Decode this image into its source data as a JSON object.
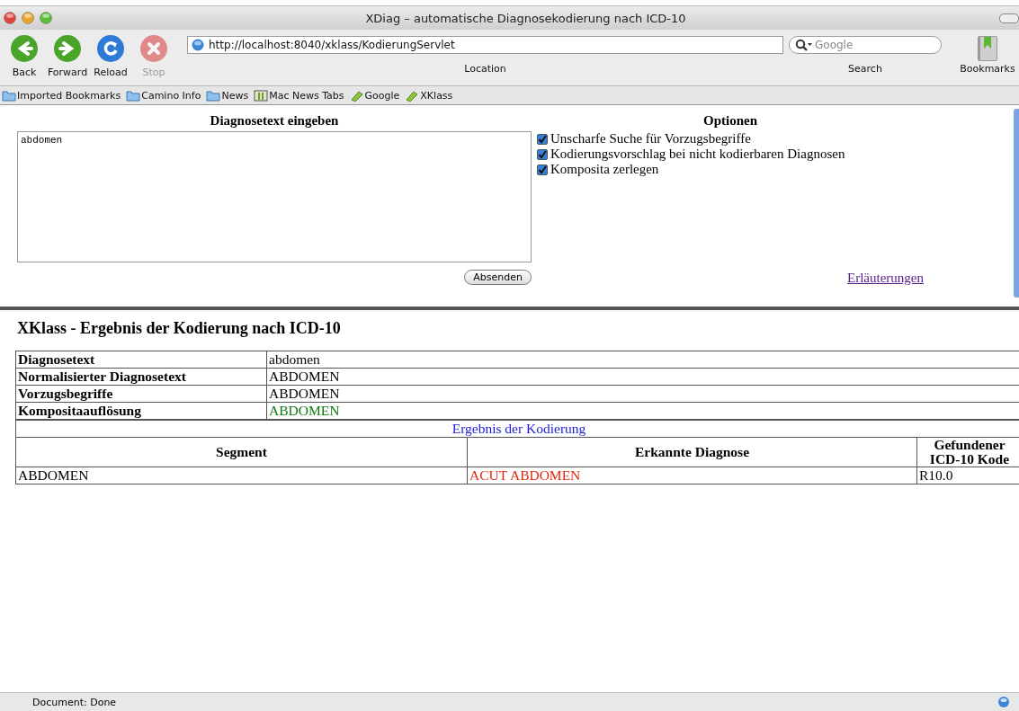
{
  "window": {
    "title": "XDiag – automatische Diagnosekodierung nach ICD-10"
  },
  "toolbar": {
    "buttons": [
      {
        "label": "Back",
        "kind": "back",
        "disabled": false
      },
      {
        "label": "Forward",
        "kind": "forward",
        "disabled": false
      },
      {
        "label": "Reload",
        "kind": "reload",
        "disabled": false
      },
      {
        "label": "Stop",
        "kind": "stop",
        "disabled": true
      }
    ],
    "location": {
      "value": "http://localhost:8040/xklass/KodierungServlet",
      "label": "Location"
    },
    "search": {
      "placeholder": "Google",
      "label": "Search"
    },
    "bookmarks_button": {
      "label": "Bookmarks"
    }
  },
  "bookmarks_bar": [
    {
      "label": "Imported Bookmarks",
      "kind": "folder"
    },
    {
      "label": "Camino Info",
      "kind": "folder"
    },
    {
      "label": "News",
      "kind": "folder"
    },
    {
      "label": "Mac News Tabs",
      "kind": "tabs"
    },
    {
      "label": "Google",
      "kind": "link"
    },
    {
      "label": "XKlass",
      "kind": "link"
    }
  ],
  "form": {
    "heading": "Diagnosetext eingeben",
    "text": "abdomen",
    "submit": "Absenden"
  },
  "options": {
    "heading": "Optionen",
    "items": [
      {
        "label": "Unscharfe Suche für Vorzugsbegriffe",
        "checked": true
      },
      {
        "label": "Kodierungsvorschlag bei nicht kodierbaren Diagnosen",
        "checked": true
      },
      {
        "label": "Komposita zerlegen",
        "checked": true
      }
    ],
    "link": "Erläuterungen"
  },
  "result": {
    "title": "XKlass - Ergebnis der Kodierung nach ICD-10",
    "info_rows": [
      {
        "label": "Diagnosetext",
        "value": "abdomen",
        "color": "#000000"
      },
      {
        "label": "Normalisierter Diagnosetext",
        "value": "ABDOMEN",
        "color": "#000000"
      },
      {
        "label": "Vorzugsbegriffe",
        "value": "ABDOMEN",
        "color": "#000000"
      },
      {
        "label": "Kompositaauflösung",
        "value": "ABDOMEN",
        "color": "#0a7a0a"
      }
    ],
    "section_title": "Ergebnis der Kodierung",
    "columns": [
      "Segment",
      "Erkannte Diagnose",
      "Gefundener ICD-10 Kode"
    ],
    "rows": [
      {
        "segment": "ABDOMEN",
        "diagnosis": "ACUT ABDOMEN",
        "code": "R10.0"
      }
    ]
  },
  "status_bar": {
    "text": "Document: Done"
  }
}
